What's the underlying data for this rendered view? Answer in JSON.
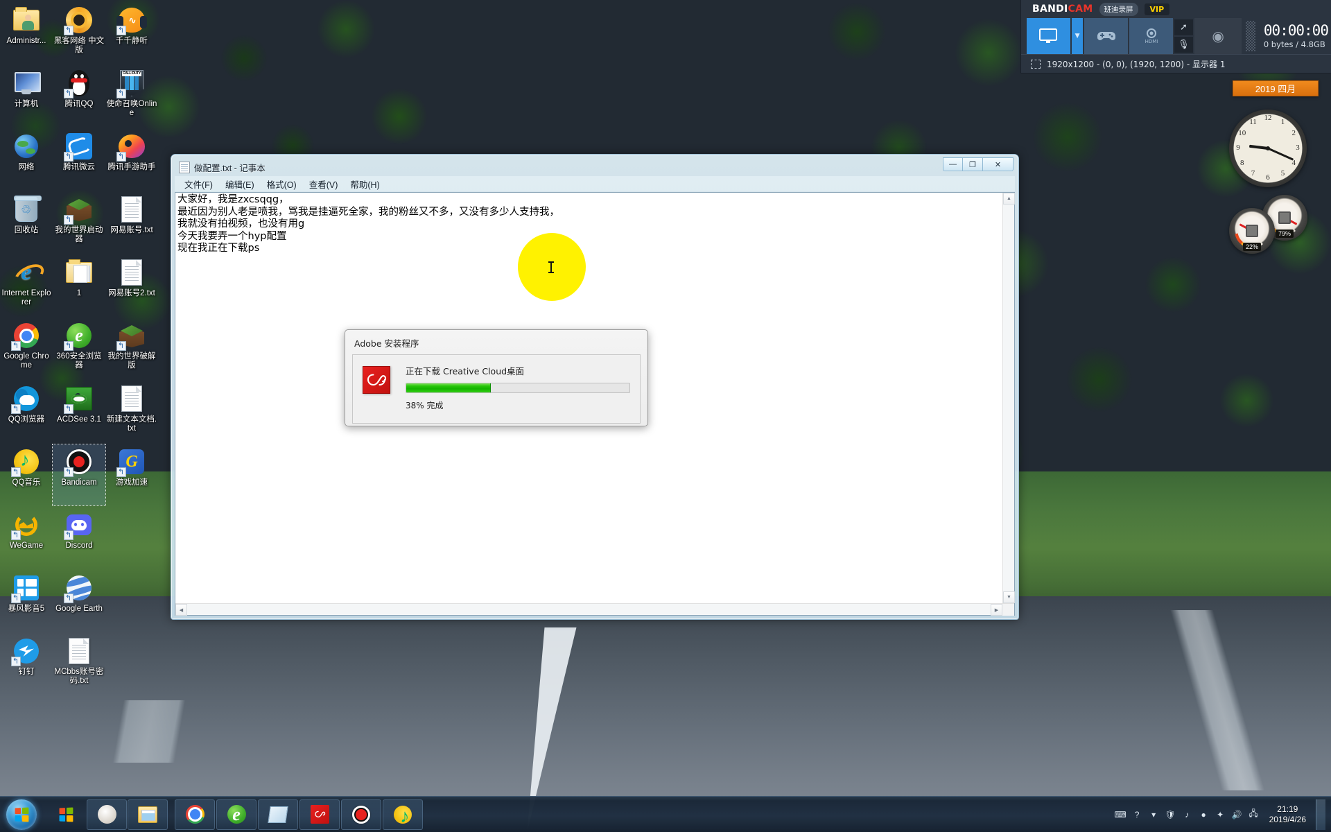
{
  "desktop": {
    "icons": [
      {
        "label": "Administr...",
        "art": "folder-person",
        "shortcut": false,
        "selected": false
      },
      {
        "label": "黑客网络 中文版",
        "art": "ring",
        "shortcut": true,
        "selected": false
      },
      {
        "label": "千千静听",
        "art": "headphones",
        "shortcut": true,
        "selected": false
      },
      {
        "label": "计算机",
        "art": "computer",
        "shortcut": false,
        "selected": false
      },
      {
        "label": "腾讯QQ",
        "art": "penguin",
        "shortcut": true,
        "selected": false
      },
      {
        "label": "使命召唤Online",
        "art": "call-of-duty",
        "shortcut": true,
        "selected": false
      },
      {
        "label": "网络",
        "art": "network",
        "shortcut": false,
        "selected": false
      },
      {
        "label": "腾讯微云",
        "art": "weiyun-cloud",
        "shortcut": true,
        "selected": false
      },
      {
        "label": "腾讯手游助手",
        "art": "tencent-gamehelper",
        "shortcut": true,
        "selected": false
      },
      {
        "label": "回收站",
        "art": "recycle-bin",
        "shortcut": false,
        "selected": false
      },
      {
        "label": "我的世界启动器",
        "art": "minecraft-block",
        "shortcut": true,
        "selected": false
      },
      {
        "label": "网易账号.txt",
        "art": "text-file",
        "shortcut": false,
        "selected": false
      },
      {
        "label": "Internet Explorer",
        "art": "internet-explorer",
        "shortcut": false,
        "selected": false
      },
      {
        "label": "1",
        "art": "folder",
        "shortcut": false,
        "selected": false
      },
      {
        "label": "网易账号2.txt",
        "art": "text-file",
        "shortcut": false,
        "selected": false
      },
      {
        "label": "Google Chrome",
        "art": "chrome",
        "shortcut": true,
        "selected": false
      },
      {
        "label": "360安全浏览器",
        "art": "browser-360",
        "shortcut": true,
        "selected": false
      },
      {
        "label": "我的世界破解版",
        "art": "minecraft-block",
        "shortcut": true,
        "selected": false
      },
      {
        "label": "QQ浏览器",
        "art": "qq-browser",
        "shortcut": true,
        "selected": false
      },
      {
        "label": "ACDSee 3.1",
        "art": "acdsee-eye",
        "shortcut": true,
        "selected": false
      },
      {
        "label": "新建文本文档.txt",
        "art": "text-file",
        "shortcut": false,
        "selected": false
      },
      {
        "label": "QQ音乐",
        "art": "qq-music",
        "shortcut": true,
        "selected": false
      },
      {
        "label": "Bandicam",
        "art": "bandicam-record",
        "shortcut": true,
        "selected": true
      },
      {
        "label": "游戏加速",
        "art": "game-booster",
        "shortcut": true,
        "selected": false
      },
      {
        "label": "WeGame",
        "art": "wegame",
        "shortcut": true,
        "selected": false
      },
      {
        "label": "Discord",
        "art": "discord",
        "shortcut": true,
        "selected": false
      },
      {
        "label": "",
        "art": "none",
        "shortcut": false,
        "selected": false
      },
      {
        "label": "暴风影音5",
        "art": "baofeng",
        "shortcut": true,
        "selected": false
      },
      {
        "label": "Google Earth",
        "art": "google-earth",
        "shortcut": true,
        "selected": false
      },
      {
        "label": "",
        "art": "none",
        "shortcut": false,
        "selected": false
      },
      {
        "label": "钉钉",
        "art": "dingtalk",
        "shortcut": true,
        "selected": false
      },
      {
        "label": "MCbbs账号密码.txt",
        "art": "text-file",
        "shortcut": false,
        "selected": false
      }
    ]
  },
  "notepad": {
    "title": "做配置.txt - 记事本",
    "menu": [
      "文件(F)",
      "编辑(E)",
      "格式(O)",
      "查看(V)",
      "帮助(H)"
    ],
    "controls": {
      "minimize": "—",
      "maximize": "❐",
      "close": "✕"
    },
    "content": "大家好，我是zxcsqqg，\n最近因为别人老是喷我，骂我是挂逼死全家，我的粉丝又不多，又没有多少人支持我，\n我就没有拍视频，也没有用g\n今天我要弄一个hyp配置\n现在我正在下载ps"
  },
  "adobe_dialog": {
    "title": "Adobe 安装程序",
    "status": "正在下载 Creative Cloud桌面",
    "percent_label": "38% 完成",
    "progress_percent": 38,
    "logo_name": "creative-cloud-logo",
    "progress_color": "#1dbd00"
  },
  "bandicam": {
    "logo_white": "BANDI",
    "logo_red": "CAM",
    "cn_badge": "班迪录屏",
    "vip_badge": "VIP",
    "timer": "00:00:00",
    "size_info": "0 bytes / 4.8GB",
    "resolution_info": "1920x1200 - (0, 0), (1920, 1200) - 显示器 1",
    "tools": [
      {
        "name": "screen-rec-mode",
        "icon": "monitor-icon",
        "active": true
      },
      {
        "name": "game-rec-mode",
        "icon": "gamepad-icon",
        "active": false
      },
      {
        "name": "device-rec-mode",
        "icon": "hdmi-icon",
        "active": false
      }
    ],
    "accent": "#2f8fe0"
  },
  "gadgets": {
    "calendar_label": "2019 四月",
    "clock_numbers": [
      "12",
      "1",
      "2",
      "3",
      "4",
      "5",
      "6",
      "7",
      "8",
      "9",
      "10",
      "11"
    ],
    "clock_time": "9:19",
    "cpu_meter": {
      "value": "22%",
      "name": "cpu-meter"
    },
    "ram_meter": {
      "value": "79%",
      "name": "ram-meter"
    }
  },
  "taskbar": {
    "start_label": "start-orb",
    "quicklaunch": [
      {
        "name": "show-desktop-quick",
        "icon": "windows-flag-icon"
      },
      {
        "name": "media-player-quick",
        "icon": "media-disc-icon"
      },
      {
        "name": "explorer-quick",
        "icon": "folder-window-icon"
      }
    ],
    "tasks": [
      {
        "name": "task-chrome",
        "icon": "chrome-icon"
      },
      {
        "name": "task-360-browser",
        "icon": "browser-360-icon"
      },
      {
        "name": "task-notepad",
        "icon": "notepad-icon"
      },
      {
        "name": "task-adobe-installer",
        "icon": "adobe-box-icon"
      },
      {
        "name": "task-bandicam",
        "icon": "bandicam-icon"
      },
      {
        "name": "task-qq-music",
        "icon": "qq-music-icon"
      }
    ],
    "tray": [
      {
        "name": "tray-keyboard-icon",
        "glyph": "⌨"
      },
      {
        "name": "tray-help-icon",
        "glyph": "?"
      },
      {
        "name": "tray-overflow-icon",
        "glyph": "▾"
      },
      {
        "name": "tray-shield-icon",
        "glyph": "🛡"
      },
      {
        "name": "tray-qq-music-icon",
        "glyph": "♪"
      },
      {
        "name": "tray-bandicam-icon",
        "glyph": "●"
      },
      {
        "name": "tray-app-icon",
        "glyph": "✦"
      },
      {
        "name": "tray-volume-icon",
        "glyph": "🔊"
      },
      {
        "name": "tray-network-icon",
        "glyph": "🖧"
      }
    ],
    "clock_time": "21:19",
    "clock_date": "2019/4/26"
  }
}
